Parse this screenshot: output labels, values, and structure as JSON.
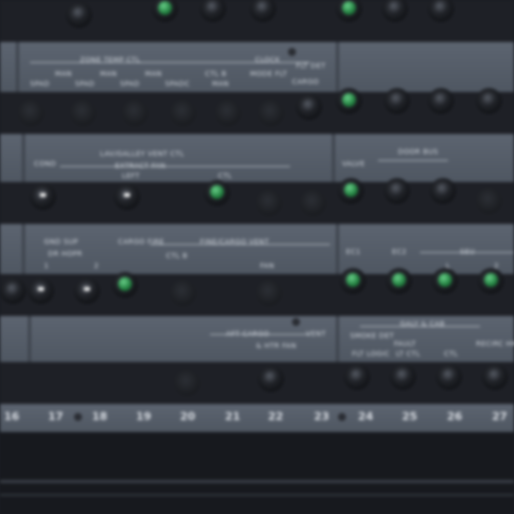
{
  "row1_labels": {
    "zone_temp_ctl": "ZONE TEMP CTL",
    "zone_a": "MAN",
    "zone_b": "MAN",
    "zone_c": "MAN",
    "zone_a_sub": "SPAD",
    "zone_b_sub": "SPAD",
    "zone_c_sub": "SPAD",
    "zone_d_sub": "SPADC",
    "ctl_b": "CTL B",
    "ctl_b_sub": "MAN",
    "clock": "CLOCK",
    "mode_flt": "MODE FLT",
    "flt_det": "FLT DET",
    "cargo": "CARGO"
  },
  "row2_labels": {
    "lav_gallery": "LAV/GALLEY VENT CTL",
    "extract_fan": "EXTRACT FAN",
    "cond": "COND",
    "left": "LEFT",
    "ctl": "CTL",
    "door_bus": "DOOR BUS",
    "valve": "VALVE"
  },
  "row3_labels": {
    "gnd_sup": "GND SUP",
    "dr_hopr": "DR HOPR",
    "ch1": "1",
    "ch2": "2",
    "cargo_fire": "CARGO FIRE",
    "fine_cargo_vent": "FINE/CARGO VENT",
    "ctl_b": "CTL B",
    "fan": "FAN",
    "ec1": "EC1",
    "ec2": "EC2",
    "seu": "SEU",
    "ch_l": "L",
    "ch_r": "2"
  },
  "row4_labels": {
    "aft_cargo": "AFT CARGO",
    "fire_fan": "& HTR FAN",
    "vent": "VENT",
    "galy_cab": "GALY & CAB",
    "smoke_det": "SMOKE DET",
    "flt_logic": "FLT LOGIC",
    "fault": "FAULT",
    "lt_ctl": "LT CTL",
    "ctl": "CTL",
    "recirc_hmr": "RECIRC HMR"
  },
  "columns": [
    "16",
    "17",
    "18",
    "19",
    "20",
    "21",
    "22",
    "23",
    "24",
    "25",
    "26",
    "27"
  ]
}
